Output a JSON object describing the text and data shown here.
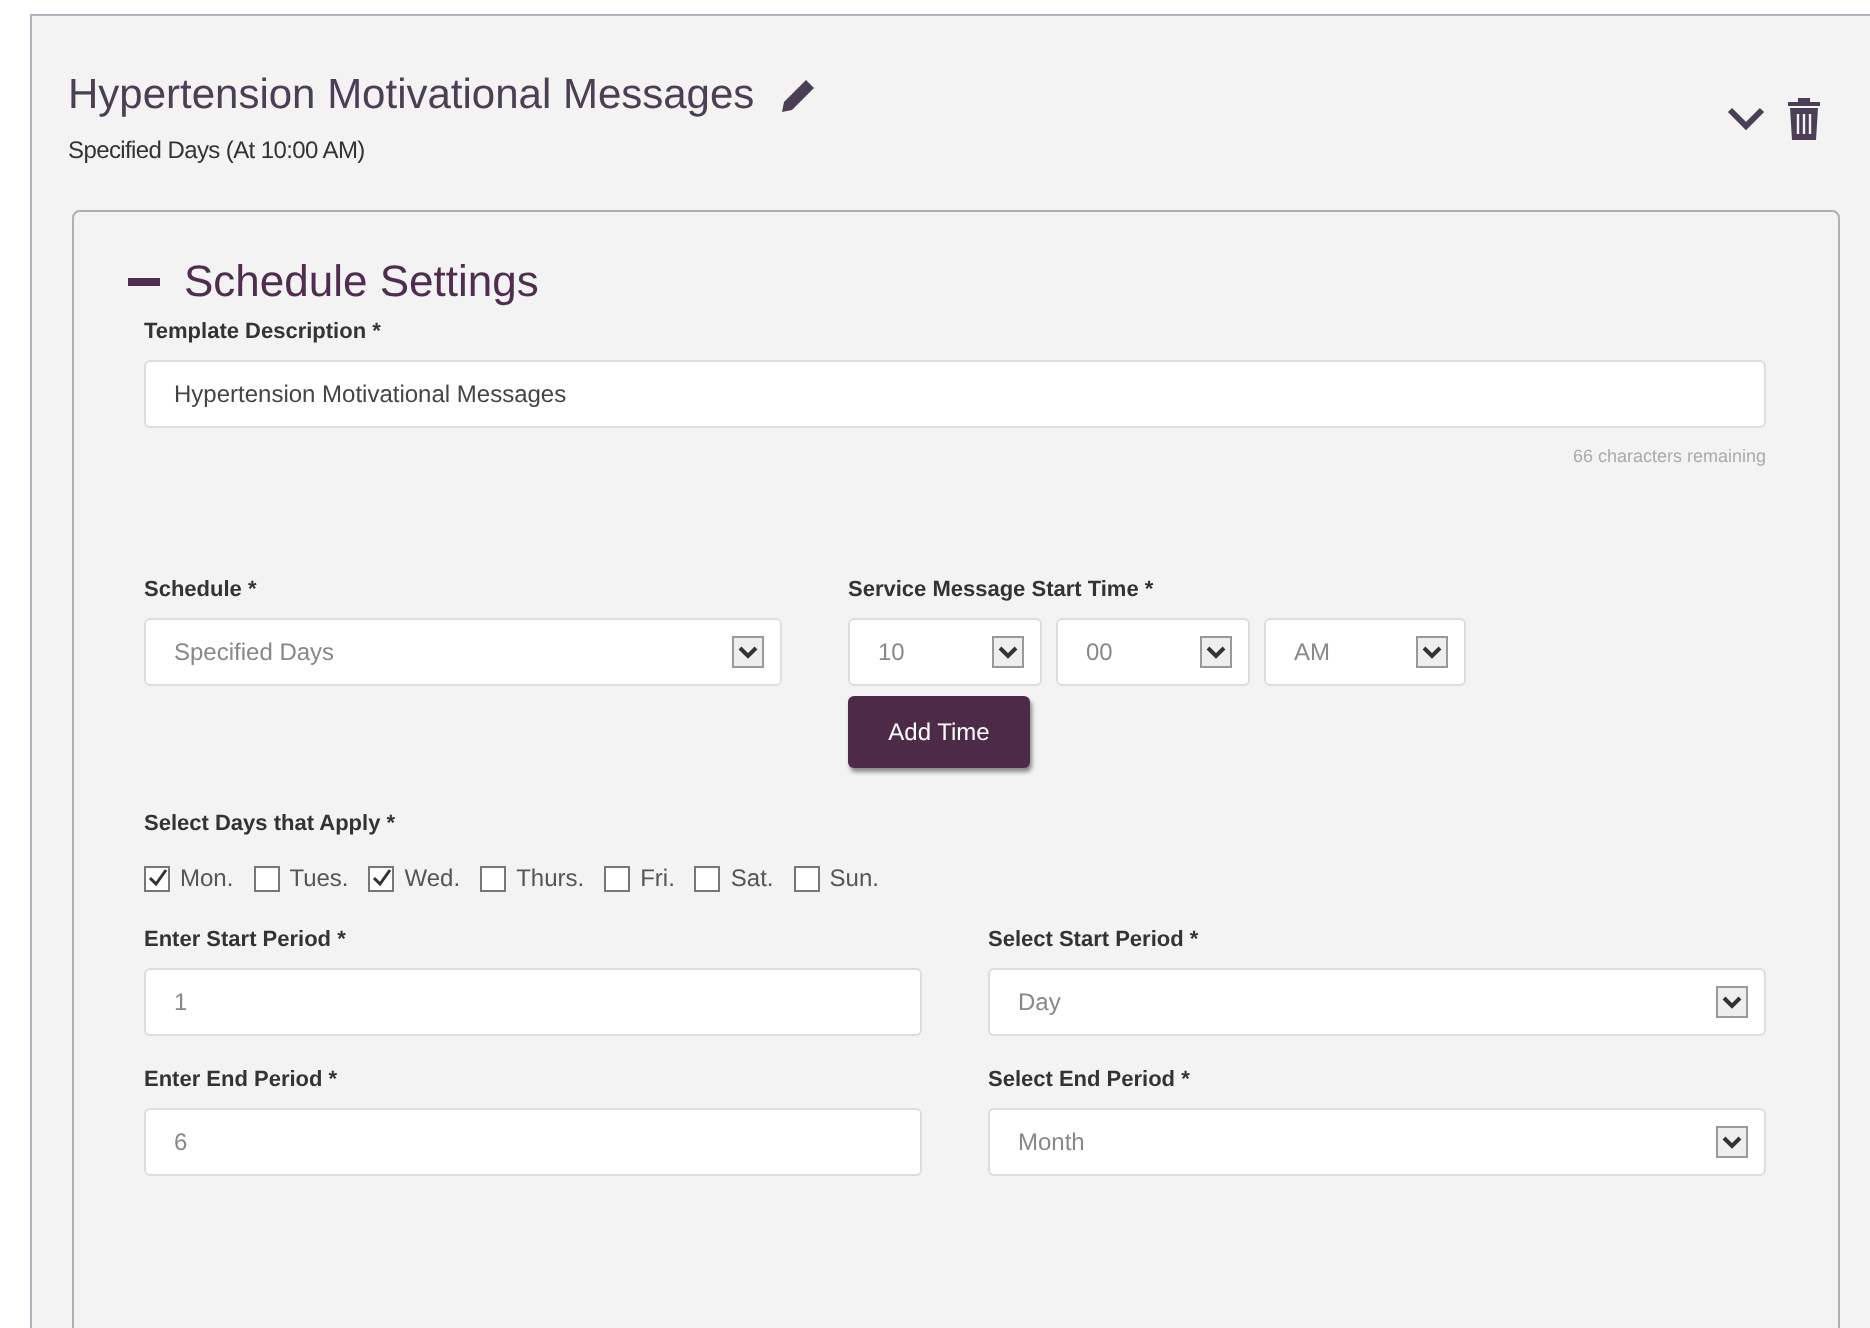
{
  "template": {
    "title": "Hypertension Motivational Messages",
    "subtitle": "Specified Days (At 10:00 AM)",
    "expanded": true
  },
  "section": {
    "title": "Schedule Settings",
    "expanded": true
  },
  "description": {
    "label": "Template Description *",
    "value": "Hypertension Motivational Messages",
    "counter": "66 characters remaining"
  },
  "schedule": {
    "label": "Schedule *",
    "value": "Specified Days"
  },
  "start_time": {
    "label": "Service Message Start Time *",
    "hour": "10",
    "minute": "00",
    "meridiem": "AM",
    "button": "Add Time"
  },
  "days": {
    "label": "Select Days that Apply *",
    "items": [
      {
        "label": "Mon.",
        "checked": true
      },
      {
        "label": "Tues.",
        "checked": false
      },
      {
        "label": "Wed.",
        "checked": true
      },
      {
        "label": "Thurs.",
        "checked": false
      },
      {
        "label": "Fri.",
        "checked": false
      },
      {
        "label": "Sat.",
        "checked": false
      },
      {
        "label": "Sun.",
        "checked": false
      }
    ]
  },
  "periods": [
    {
      "kind": "input",
      "label": "Enter Start Period *",
      "value": "1"
    },
    {
      "kind": "select",
      "label": "Select Start Period *",
      "value": "Day"
    },
    {
      "kind": "input",
      "label": "Enter End Period *",
      "value": "6"
    },
    {
      "kind": "select",
      "label": "Select End Period *",
      "value": "Month"
    }
  ]
}
